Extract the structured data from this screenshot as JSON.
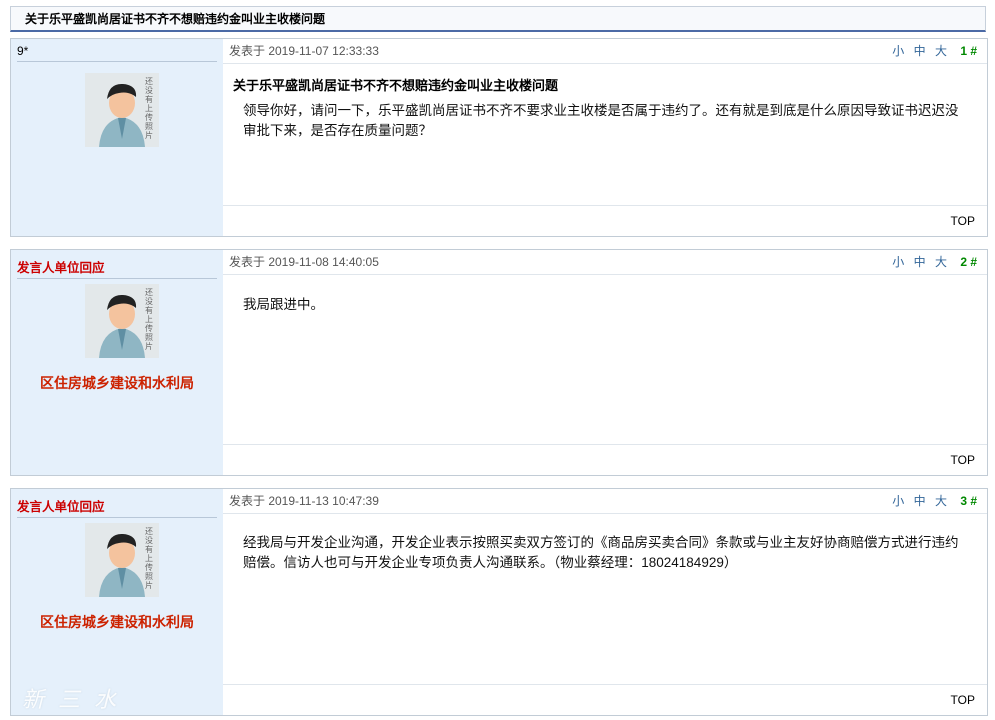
{
  "thread": {
    "title": "关于乐平盛凯尚居证书不齐不想赔违约金叫业主收楼问题"
  },
  "font_sizes": {
    "small": "小",
    "medium": "中",
    "large": "大"
  },
  "top_label": "TOP",
  "avatar_text": "还没有上传照片",
  "posts": [
    {
      "poster": "9*",
      "department": "",
      "meta": "发表于 2019-11-07 12:33:33",
      "floor": "1 #",
      "title": "关于乐平盛凯尚居证书不齐不想赔违约金叫业主收楼问题",
      "body": "领导你好，请问一下，乐平盛凯尚居证书不齐不要求业主收楼是否属于违约了。还有就是到底是什么原因导致证书迟迟没审批下来，是否存在质量问题？"
    },
    {
      "poster": "发言人单位回应",
      "department": "区住房城乡建设和水利局",
      "meta": "发表于 2019-11-08 14:40:05",
      "floor": "2 #",
      "title": "",
      "body": "我局跟进中。"
    },
    {
      "poster": "发言人单位回应",
      "department": "区住房城乡建设和水利局",
      "meta": "发表于 2019-11-13 10:47:39",
      "floor": "3 #",
      "title": "",
      "body": "经我局与开发企业沟通，开发企业表示按照买卖双方签订的《商品房买卖合同》条款或与业主友好协商赔偿方式进行违约赔偿。信访人也可与开发企业专项负责人沟通联系。（物业蔡经理：18024184929）"
    }
  ],
  "watermark": "新三水"
}
